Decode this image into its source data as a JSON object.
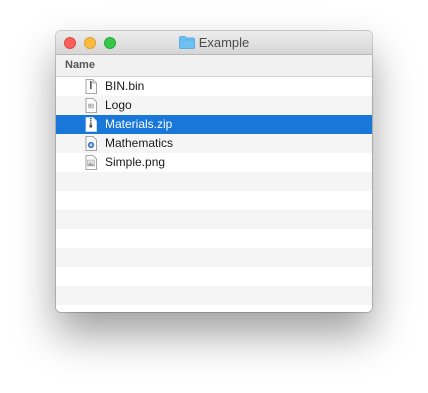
{
  "window": {
    "title": "Example",
    "folder_icon": "folder-icon",
    "accent_color": "#1877d8"
  },
  "header": {
    "name_column": "Name"
  },
  "files": [
    {
      "name": "BIN.bin",
      "icon": "document-icon",
      "selected": false
    },
    {
      "name": "Logo",
      "icon": "image-file-icon",
      "selected": false
    },
    {
      "name": "Materials.zip",
      "icon": "zip-archive-icon",
      "selected": true
    },
    {
      "name": "Mathematics",
      "icon": "app-document-icon",
      "selected": false
    },
    {
      "name": "Simple.png",
      "icon": "png-image-icon",
      "selected": false
    }
  ]
}
